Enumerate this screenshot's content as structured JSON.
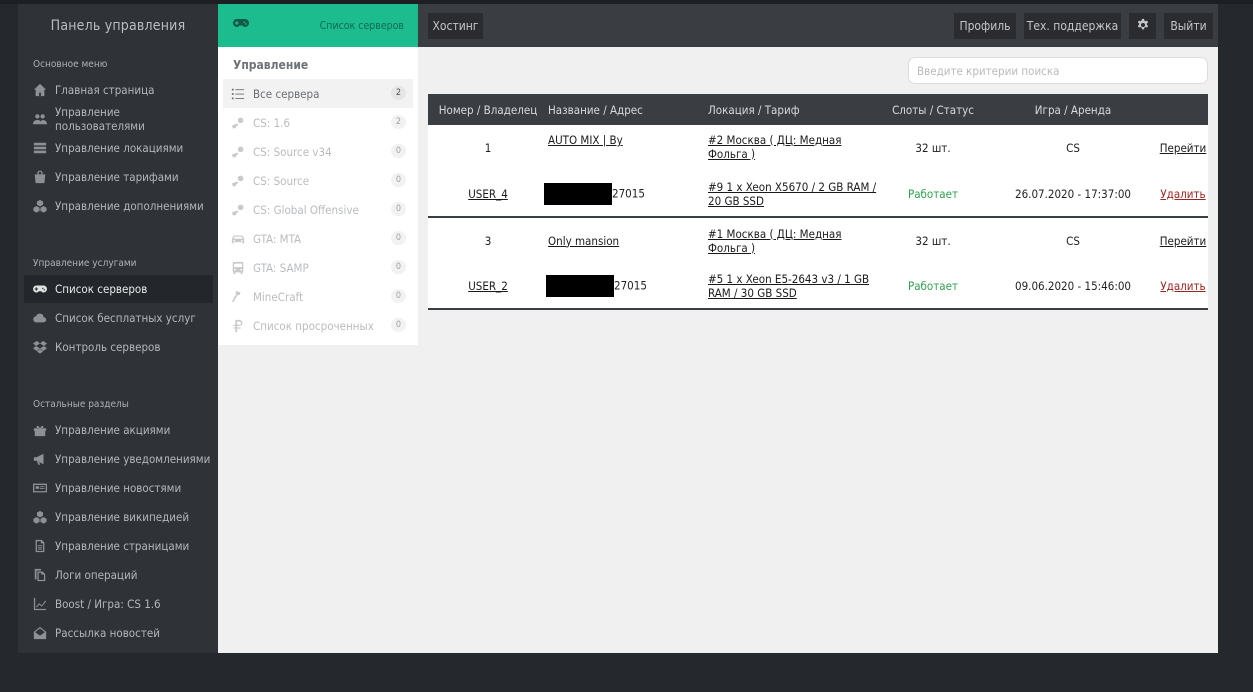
{
  "sidebar": {
    "brand": "Панель управления",
    "main_title": "Основное меню",
    "main_items": [
      {
        "icon": "home-icon",
        "label": "Главная страница"
      },
      {
        "icon": "users-icon",
        "label": "Управление пользователями"
      },
      {
        "icon": "server-stack-icon",
        "label": "Управление локациями"
      },
      {
        "icon": "shopping-bag-icon",
        "label": "Управление тарифами"
      },
      {
        "icon": "cubes-icon",
        "label": "Управление дополнениями"
      }
    ],
    "services_title": "Управление услугами",
    "services_items": [
      {
        "icon": "gamepad-icon",
        "label": "Список серверов",
        "active": true
      },
      {
        "icon": "cloud-icon",
        "label": "Список бесплатных услуг"
      },
      {
        "icon": "dropbox-icon",
        "label": "Контроль серверов"
      }
    ],
    "other_title": "Остальные разделы",
    "other_items": [
      {
        "icon": "gift-icon",
        "label": "Управление акциями"
      },
      {
        "icon": "bullhorn-icon",
        "label": "Управление уведомлениями"
      },
      {
        "icon": "newspaper-icon",
        "label": "Управление новостями"
      },
      {
        "icon": "cubes-icon",
        "label": "Управление википедией"
      },
      {
        "icon": "file-icon",
        "label": "Управление страницами"
      },
      {
        "icon": "copy-icon",
        "label": "Логи операций"
      },
      {
        "icon": "chart-line-icon",
        "label": "Boost / Игра: CS 1.6"
      },
      {
        "icon": "envelope-open-icon",
        "label": "Рассылка новостей"
      }
    ]
  },
  "topbar": {
    "section_icon": "gamepad-icon",
    "section_label": "Список серверов",
    "hosting": "Хостинг",
    "profile": "Профиль",
    "support": "Тех. поддержка",
    "settings_icon": "gear-icon",
    "logout": "Выйти"
  },
  "subnav": {
    "title": "Управление",
    "items": [
      {
        "icon": "list-icon",
        "label": "Все сервера",
        "count": "2",
        "active": true
      },
      {
        "icon": "steam-icon",
        "label": "CS: 1.6",
        "count": "2"
      },
      {
        "icon": "steam-icon",
        "label": "CS: Source v34",
        "count": "0"
      },
      {
        "icon": "steam-icon",
        "label": "CS: Source",
        "count": "0"
      },
      {
        "icon": "steam-icon",
        "label": "CS: Global Offensive",
        "count": "0"
      },
      {
        "icon": "car-icon",
        "label": "GTA: MTA",
        "count": "0"
      },
      {
        "icon": "bus-icon",
        "label": "GTA: SAMP",
        "count": "0"
      },
      {
        "icon": "hammer-icon",
        "label": "MineCraft",
        "count": "0"
      },
      {
        "icon": "ruble-icon",
        "label": "Список просроченных",
        "count": "0"
      }
    ]
  },
  "search": {
    "placeholder": "Введите критерии поиска"
  },
  "table": {
    "headers": [
      "Номер / Владелец",
      "Название / Адрес",
      "Локация / Тариф",
      "Слоты / Статус",
      "Игра / Аренда",
      ""
    ],
    "rows": [
      {
        "number": "1",
        "owner": "USER_4",
        "name": "AUTO MIX | By",
        "address_suffix": "27015",
        "location": "#2 Москва ( ДЦ: Медная Фольга )",
        "tariff": "#9 1 x Xeon X5670 / 2 GB RAM / 20 GB SSD",
        "slots": "32 шт.",
        "status": "Работает",
        "game": "CS",
        "rent": "26.07.2020 - 17:37:00",
        "goto": "Перейти",
        "delete": "Удалить"
      },
      {
        "number": "3",
        "owner": "USER_2",
        "name": "Only mansion",
        "address_suffix": "27015",
        "location": "#1 Москва ( ДЦ: Медная Фольга )",
        "tariff": "#5 1 x Xeon E5-2643 v3 / 1 GB RAM / 30 GB SSD",
        "slots": "32 шт.",
        "status": "Работает",
        "game": "CS",
        "rent": "09.06.2020 - 15:46:00",
        "goto": "Перейти",
        "delete": "Удалить"
      }
    ]
  },
  "colors": {
    "accent": "#1cbc8f",
    "status_ok": "#30a14e",
    "delete_link": "#9b2420",
    "sidebar_bg": "#2f3237"
  }
}
